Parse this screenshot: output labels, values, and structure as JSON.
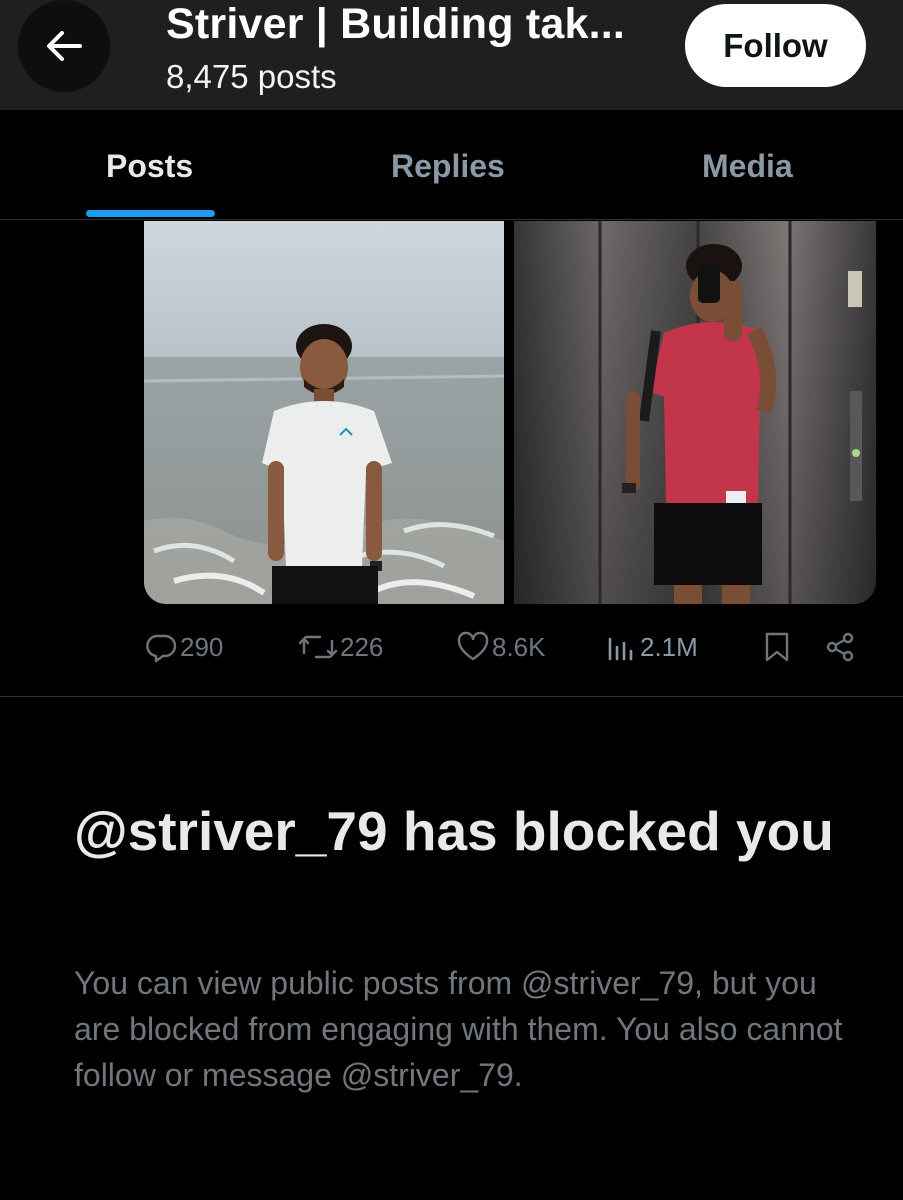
{
  "header": {
    "title": "Striver | Building tak...",
    "post_count": "8,475 posts",
    "follow_label": "Follow"
  },
  "tabs": [
    {
      "label": "Posts",
      "active": true
    },
    {
      "label": "Replies",
      "active": false
    },
    {
      "label": "Media",
      "active": false
    }
  ],
  "post": {
    "media": [
      {
        "icon": "photo-beach"
      },
      {
        "icon": "photo-elevator-selfie"
      }
    ],
    "actions": {
      "replies": "290",
      "reposts": "226",
      "likes": "8.6K",
      "views": "2.1M"
    }
  },
  "blocked": {
    "title": "@striver_79 has blocked you",
    "description": "You can view public posts from @striver_79, but you are blocked from engaging with them. You also cannot follow or message @striver_79."
  },
  "colors": {
    "accent": "#1d9bf0",
    "header_bg": "#1f1f21",
    "muted_text": "#71767b"
  }
}
